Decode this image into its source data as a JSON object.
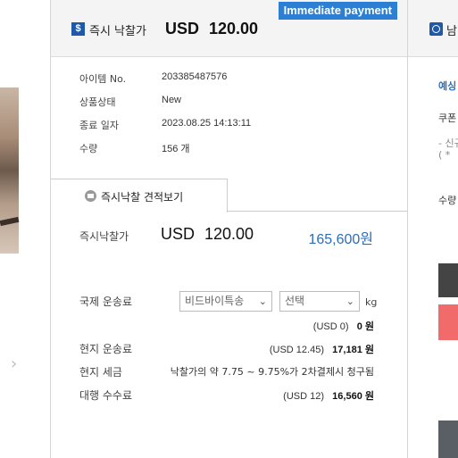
{
  "header": {
    "badge": "Immediate payment",
    "title": "즉시 낙찰가",
    "price": "USD 120.00"
  },
  "info": [
    {
      "label": "아이템 No.",
      "value": "203385487576"
    },
    {
      "label": "상품상태",
      "value": "New"
    },
    {
      "label": "종료 일자",
      "value": "2023.08.25 14:13:11"
    },
    {
      "label": "수량",
      "value": "156 개"
    }
  ],
  "tab": {
    "label": "즉시낙찰 견적보기"
  },
  "quote": {
    "label": "즉시낙찰가",
    "usd": "USD 120.00",
    "krw": "165,600원"
  },
  "shipping": {
    "intl_label": "국제 운송료",
    "method_select": "비드바이특송",
    "weight_select": "선택",
    "unit": "kg",
    "intl_usd": "(USD 0)",
    "intl_krw": "0 원",
    "local_label": "현지 운송료",
    "local_usd": "(USD 12.45)",
    "local_krw": "17,181 원",
    "tax_label": "현지 세금",
    "tax_text": "낙찰가의 약 7.75 ~ 9.75%가 2차결제시 청구됨",
    "fee_label": "대행 수수료",
    "fee_usd": "(USD 12)",
    "fee_krw": "16,560 원"
  },
  "right_panel": {
    "title": "남",
    "line1": "예싱",
    "line2": "쿠폰",
    "line3": "- 신규",
    "line4": "( *",
    "line5": "수량"
  },
  "colors": {
    "badge": "#2d7fd3",
    "icon": "#1e5aa8",
    "krw_price": "#2d6db5",
    "dark_block": "#444444",
    "red_block": "#f26b6b",
    "gray_block": "#5a5f66"
  }
}
